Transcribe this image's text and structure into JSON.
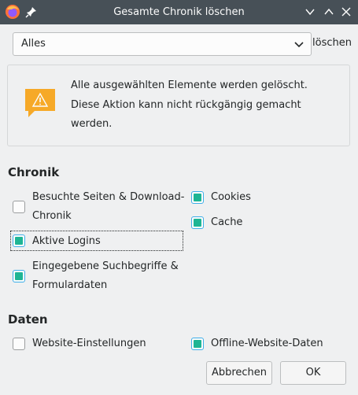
{
  "window": {
    "title": "Gesamte Chronik löschen",
    "icons": [
      "firefox-icon",
      "pin-icon",
      "minimize-icon",
      "maximize-icon",
      "close-icon"
    ]
  },
  "range": {
    "selected": "Alles",
    "suffix": "löschen"
  },
  "warning": {
    "line1": "Alle ausgewählten Elemente werden gelöscht.",
    "line2": "Diese Aktion kann nicht rückgängig gemacht",
    "line3": "werden."
  },
  "history": {
    "heading": "Chronik",
    "items": [
      {
        "label_line1": "Besuchte Seiten & Download-",
        "label_line2": "Chronik",
        "checked": false
      },
      {
        "label": "Aktive Logins",
        "checked": true
      },
      {
        "label_line1": "Eingegebene Suchbegriffe &",
        "label_line2": "Formulardaten",
        "checked": true
      },
      {
        "label": "Cookies",
        "checked": true
      },
      {
        "label": "Cache",
        "checked": true
      }
    ]
  },
  "data": {
    "heading": "Daten",
    "items": [
      {
        "label": "Website-Einstellungen",
        "checked": false
      },
      {
        "label": "Offline-Website-Daten",
        "checked": true
      }
    ]
  },
  "buttons": {
    "cancel": "Abbrechen",
    "ok": "OK"
  },
  "colors": {
    "titlebar": "#475057",
    "checkbox_fill": "#1fb594",
    "focus": "#3daee9",
    "warning": "#f6a928"
  }
}
